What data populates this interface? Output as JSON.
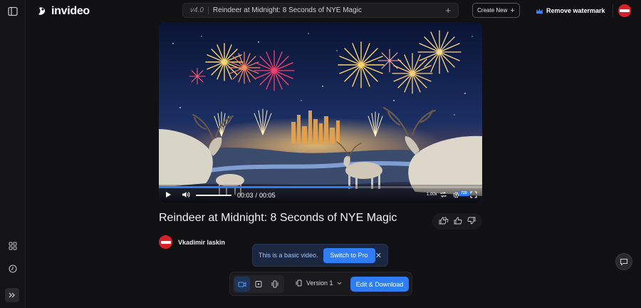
{
  "header": {
    "logo_text": "invideo",
    "version": "v4.0",
    "project_title": "Reindeer at Midnight: 8 Seconds of NYE Magic",
    "add_icon": "plus-icon",
    "create_new_label": "Create New",
    "remove_watermark_label": "Remove watermark"
  },
  "player": {
    "time_current": "00:03",
    "time_sep": "/",
    "time_total": "00:05",
    "progress": 0.6,
    "volume": 1.0,
    "speed": "1.00x",
    "resolution": "720"
  },
  "video": {
    "title": "Reindeer at Midnight: 8 Seconds of NYE Magic",
    "channel_name": "Vkadimir laskin"
  },
  "banner": {
    "message": "This is a basic video.",
    "cta_label": "Switch to Pro"
  },
  "toolbar": {
    "version_label": "Version 1",
    "edit_download_label": "Edit & Download"
  },
  "colors": {
    "accent": "#2f7df6",
    "background": "#111113",
    "avatar": "#d8202a"
  }
}
